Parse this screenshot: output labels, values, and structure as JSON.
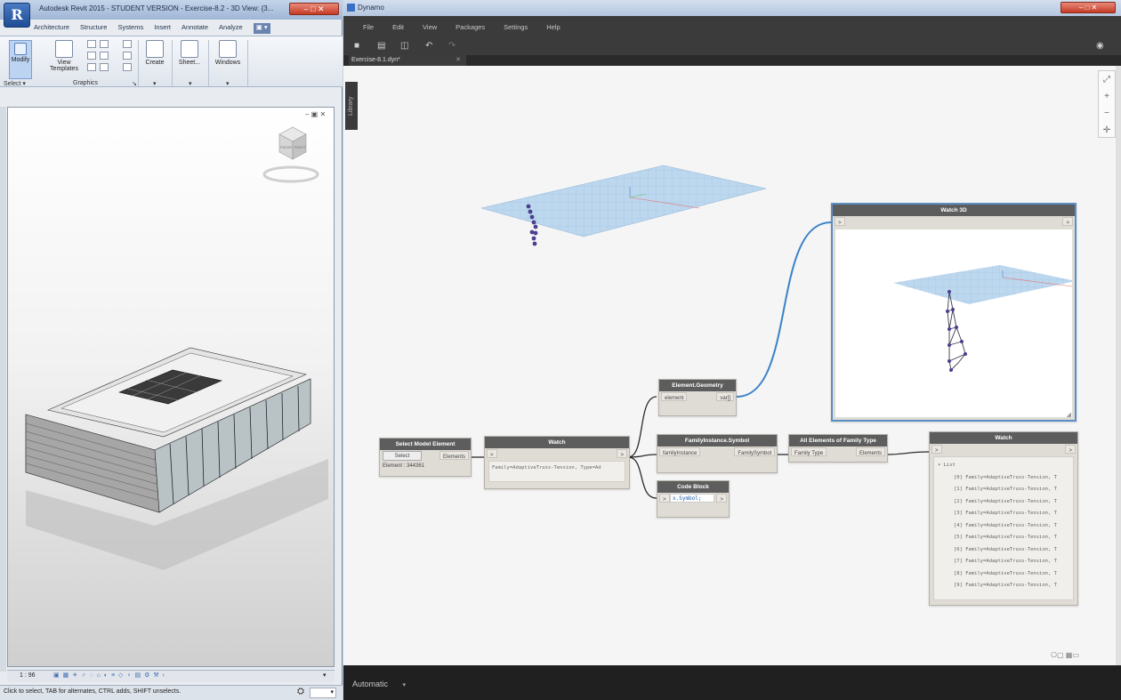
{
  "revit": {
    "title": "Autodesk Revit 2015 - STUDENT VERSION -    Exercise-8.2 - 3D View: {3...",
    "app_icon": "R",
    "window_controls": "– □ ✕",
    "ribbon_tabs": [
      "Architecture",
      "Structure",
      "Systems",
      "Insert",
      "Annotate",
      "Analyze"
    ],
    "ribbon_tab_toggle": "▣ ▾",
    "ribbon": {
      "modify": "Modify",
      "view_templates_line1": "View",
      "view_templates_line2": "Templates",
      "create": "Create",
      "sheet": "Sheet...",
      "windows": "Windows",
      "panel_select": "Select",
      "panel_graphics": "Graphics",
      "dropdown_glyph": "▾",
      "launcher_glyph": "↘"
    },
    "viewport_controls": "– ▣ ✕",
    "view_cube": {
      "line1": "FRONT",
      "line2": "RIGHT"
    },
    "scale": "1 : 96",
    "scale_icons": "▣ ▦ ☀ ♂ ◌ ⌂ ◐ ≡ ◇ ♀ ▤ ⚙ ⚒ ‹",
    "status": "Click to select, TAB for alternates, CTRL adds, SHIFT unselects.",
    "status_icon": "⛭",
    "status_field": "▾",
    "scroll_arrow": "▾"
  },
  "dynamo": {
    "title": "Dynamo",
    "window_controls": "– □ ✕",
    "menu": [
      "File",
      "Edit",
      "View",
      "Packages",
      "Settings",
      "Help"
    ],
    "toolbar_icons": [
      "new-file",
      "open-file",
      "save-file",
      "undo",
      "redo"
    ],
    "toolbar_glyphs": [
      "■",
      "▤",
      "◫",
      "↶",
      "↷"
    ],
    "camera_glyph": "◉",
    "tab_label": "Exercise-8.1.dyn*",
    "tab_close": "✕",
    "library_label": "Library",
    "nav_glyphs": [
      "⤢",
      "+",
      "−",
      "✛"
    ],
    "run_mode": "Automatic",
    "run_mode_caret": "▾",
    "view_toggle": "⎔▢  ▦▭",
    "resize_glyph": "◢",
    "nodes": {
      "select_model_element": {
        "title": "Select Model Element",
        "button": "Select",
        "output": "Elements",
        "info": "Element : 344361"
      },
      "watch1": {
        "title": "Watch",
        "input": ">",
        "output": ">",
        "value": "Family=AdaptiveTruss-Tension, Type=Ad"
      },
      "element_geometry": {
        "title": "Element.Geometry",
        "input": "element",
        "output": "var[]"
      },
      "familyinstance_symbol": {
        "title": "FamilyInstance.Symbol",
        "input": "familyInstance",
        "output": "FamilySymbol"
      },
      "code_block": {
        "title": "Code Block",
        "code": "x.Symbol;",
        "output": ">",
        "input": ">"
      },
      "all_elements_of_family_type": {
        "title": "All Elements of Family Type",
        "input": "Family Type",
        "output": "Elements"
      },
      "watch3d": {
        "title": "Watch 3D",
        "input": ">",
        "output": ">"
      },
      "watch2": {
        "title": "Watch",
        "input": ">",
        "output": ">",
        "list_header": "▾ List",
        "items": [
          "[0] Family=AdaptiveTruss-Tension, T",
          "[1] Family=AdaptiveTruss-Tension, T",
          "[2] Family=AdaptiveTruss-Tension, T",
          "[3] Family=AdaptiveTruss-Tension, T",
          "[4] Family=AdaptiveTruss-Tension, T",
          "[5] Family=AdaptiveTruss-Tension, T",
          "[6] Family=AdaptiveTruss-Tension, T",
          "[7] Family=AdaptiveTruss-Tension, T",
          "[8] Family=AdaptiveTruss-Tension, T",
          "[9] Family=AdaptiveTruss-Tension, T"
        ]
      }
    }
  },
  "colors": {
    "wire_blue": "#3b82c8",
    "node_header": "#5d5d5d",
    "grid_plane": "#a9c9e4",
    "dynamo_chrome": "#3b3b3b"
  }
}
